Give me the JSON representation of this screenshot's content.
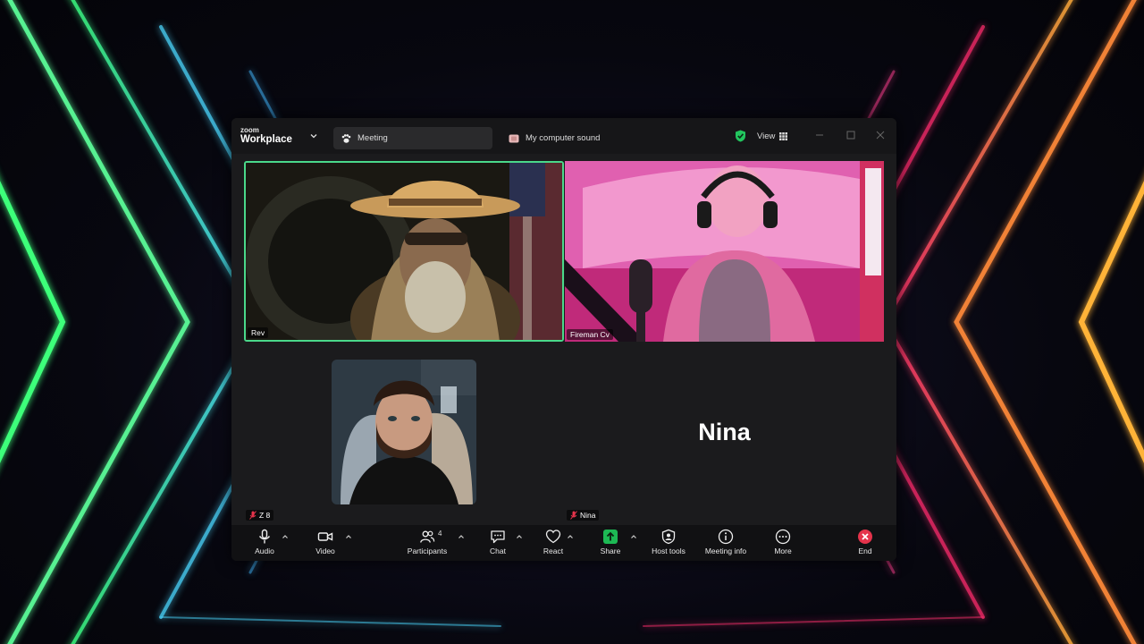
{
  "window": {
    "brand_small": "zoom",
    "brand_large": "Workplace",
    "tabs": [
      {
        "label": "Meeting",
        "icon": "paw-icon",
        "active": true
      },
      {
        "label": "My computer sound",
        "icon": "speaker-app-icon",
        "active": false
      }
    ],
    "view_label": "View",
    "shield_color": "#22c55e"
  },
  "participants": [
    {
      "name": "Rev",
      "active_speaker": true,
      "muted": false
    },
    {
      "name": "Fireman Cv",
      "active_speaker": false,
      "muted": false
    },
    {
      "name": "Z 8",
      "active_speaker": false,
      "muted": true
    },
    {
      "name": "Nina",
      "active_speaker": false,
      "muted": true,
      "video_off": true,
      "display_name": "Nina"
    }
  ],
  "toolbar": {
    "audio": "Audio",
    "video": "Video",
    "participants": "Participants",
    "participant_count": "4",
    "chat": "Chat",
    "react": "React",
    "share": "Share",
    "host_tools": "Host tools",
    "meeting_info": "Meeting info",
    "more": "More",
    "end": "End"
  },
  "colors": {
    "active_border": "#4ad88a",
    "share_green": "#1db954",
    "end_red": "#e5334b",
    "muted_red": "#e5334b"
  }
}
